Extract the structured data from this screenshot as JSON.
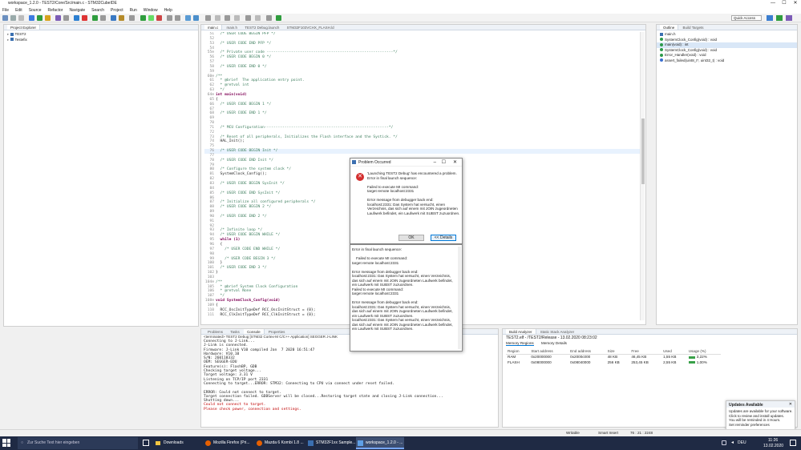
{
  "window": {
    "title": "workspace_1.2.0 - TEST2/Core/Src/main.c - STM32CubeIDE",
    "controls": [
      "—",
      "☐",
      "✕"
    ]
  },
  "menu": [
    "File",
    "Edit",
    "Source",
    "Refactor",
    "Navigate",
    "Search",
    "Project",
    "Run",
    "Window",
    "Help"
  ],
  "quick_access": "Quick Access",
  "project_explorer": {
    "title": "Project Explorer",
    "items": [
      "TEST2",
      "Testefix"
    ]
  },
  "editor": {
    "tabs": [
      "main.c",
      "main.h",
      "TEST2 Debug.launch",
      "STM32F103VCHX_FLASH.ld"
    ],
    "lines": [
      {
        "n": "51",
        "t": "  /* USER CODE BEGIN PFP */",
        "c": "cm"
      },
      {
        "n": "52",
        "t": "",
        "c": ""
      },
      {
        "n": "53",
        "t": "  /* USER CODE END PFP */",
        "c": "cm"
      },
      {
        "n": "54",
        "t": "",
        "c": ""
      },
      {
        "n": "55⊖",
        "t": "  /* Private user code ---------------------------------------------------------*/",
        "c": "cm"
      },
      {
        "n": "56",
        "t": "  /* USER CODE BEGIN 0 */",
        "c": "cm"
      },
      {
        "n": "57",
        "t": "",
        "c": ""
      },
      {
        "n": "58",
        "t": "  /* USER CODE END 0 */",
        "c": "cm"
      },
      {
        "n": "59",
        "t": "",
        "c": ""
      },
      {
        "n": "60⊖",
        "t": "/**",
        "c": "cm"
      },
      {
        "n": "61",
        "t": "  * @brief  The application entry point.",
        "c": "cm"
      },
      {
        "n": "62",
        "t": "  * @retval int",
        "c": "cm"
      },
      {
        "n": "63",
        "t": "  */",
        "c": "cm"
      },
      {
        "n": "64⊖",
        "t": "int main(void)",
        "c": "kw"
      },
      {
        "n": "65",
        "t": "{",
        "c": ""
      },
      {
        "n": "66",
        "t": "  /* USER CODE BEGIN 1 */",
        "c": "cm"
      },
      {
        "n": "67",
        "t": "",
        "c": ""
      },
      {
        "n": "68",
        "t": "  /* USER CODE END 1 */",
        "c": "cm"
      },
      {
        "n": "69",
        "t": "",
        "c": ""
      },
      {
        "n": "70",
        "t": "",
        "c": ""
      },
      {
        "n": "71",
        "t": "  /* MCU Configuration--------------------------------------------------------*/",
        "c": "cm"
      },
      {
        "n": "72",
        "t": "",
        "c": ""
      },
      {
        "n": "73",
        "t": "  /* Reset of all peripherals, Initializes the Flash interface and the Systick. */",
        "c": "cm"
      },
      {
        "n": "74",
        "t": "  HAL_Init();",
        "c": ""
      },
      {
        "n": "75",
        "t": "",
        "c": ""
      },
      {
        "n": "76",
        "t": "  /* USER CODE BEGIN Init */",
        "c": "cm hl"
      },
      {
        "n": "77",
        "t": "",
        "c": ""
      },
      {
        "n": "78",
        "t": "  /* USER CODE END Init */",
        "c": "cm"
      },
      {
        "n": "79",
        "t": "",
        "c": ""
      },
      {
        "n": "80",
        "t": "  /* Configure the system clock */",
        "c": "cm"
      },
      {
        "n": "81",
        "t": "  SystemClock_Config();",
        "c": ""
      },
      {
        "n": "82",
        "t": "",
        "c": ""
      },
      {
        "n": "83",
        "t": "  /* USER CODE BEGIN SysInit */",
        "c": "cm"
      },
      {
        "n": "84",
        "t": "",
        "c": ""
      },
      {
        "n": "85",
        "t": "  /* USER CODE END SysInit */",
        "c": "cm"
      },
      {
        "n": "86",
        "t": "",
        "c": ""
      },
      {
        "n": "87",
        "t": "  /* Initialize all configured peripherals */",
        "c": "cm"
      },
      {
        "n": "88",
        "t": "  /* USER CODE BEGIN 2 */",
        "c": "cm"
      },
      {
        "n": "89",
        "t": "",
        "c": ""
      },
      {
        "n": "90",
        "t": "  /* USER CODE END 2 */",
        "c": "cm"
      },
      {
        "n": "91",
        "t": "",
        "c": ""
      },
      {
        "n": "92",
        "t": "",
        "c": ""
      },
      {
        "n": "93",
        "t": "  /* Infinite loop */",
        "c": "cm"
      },
      {
        "n": "94",
        "t": "  /* USER CODE BEGIN WHILE */",
        "c": "cm"
      },
      {
        "n": "95",
        "t": "  while (1)",
        "c": "kw"
      },
      {
        "n": "96",
        "t": "  {",
        "c": ""
      },
      {
        "n": "97",
        "t": "    /* USER CODE END WHILE */",
        "c": "cm"
      },
      {
        "n": "98",
        "t": "",
        "c": ""
      },
      {
        "n": "99",
        "t": "    /* USER CODE BEGIN 3 */",
        "c": "cm"
      },
      {
        "n": "100",
        "t": "  }",
        "c": ""
      },
      {
        "n": "101",
        "t": "  /* USER CODE END 3 */",
        "c": "cm"
      },
      {
        "n": "102",
        "t": "}",
        "c": ""
      },
      {
        "n": "103",
        "t": "",
        "c": ""
      },
      {
        "n": "104⊖",
        "t": "/**",
        "c": "cm"
      },
      {
        "n": "105",
        "t": "  * @brief System Clock Configuration",
        "c": "cm"
      },
      {
        "n": "106",
        "t": "  * @retval None",
        "c": "cm"
      },
      {
        "n": "107",
        "t": "  */",
        "c": "cm"
      },
      {
        "n": "108⊖",
        "t": "void SystemClock_Config(void)",
        "c": "kw"
      },
      {
        "n": "109",
        "t": "{",
        "c": ""
      },
      {
        "n": "110",
        "t": "  RCC_OscInitTypeDef RCC_OscInitStruct = {0};",
        "c": ""
      },
      {
        "n": "111",
        "t": "  RCC_ClkInitTypeDef RCC_ClkInitStruct = {0};",
        "c": ""
      }
    ]
  },
  "outline": {
    "tabs": [
      "Outline",
      "Build Targets"
    ],
    "items": [
      {
        "label": "main.h",
        "kind": "sq"
      },
      {
        "label": "SystemClock_Config(void) : void",
        "kind": "dot"
      },
      {
        "label": "main(void) : int",
        "kind": "dot"
      },
      {
        "label": "SystemClock_Config(void) : void",
        "kind": "dot"
      },
      {
        "label": "Error_Handler(void) : void",
        "kind": "dot"
      },
      {
        "label": "assert_failed(uint8_t*, uint32_t) : void",
        "kind": "dot"
      }
    ]
  },
  "console": {
    "tabs": [
      "Problems",
      "Tasks",
      "Console",
      "Properties"
    ],
    "header": "<terminated> TEST2 Debug [STM32 Cortex-M C/C++ Application] SEGGER J-LINK",
    "lines": [
      {
        "t": "Connecting to J-Link...",
        "c": ""
      },
      {
        "t": "J-Link is connected.",
        "c": ""
      },
      {
        "t": "Firmware: J-Link V10 compiled Jan  7 2020 16:51:47",
        "c": ""
      },
      {
        "t": "Hardware: V10.10",
        "c": ""
      },
      {
        "t": "S/N: 260118332",
        "c": ""
      },
      {
        "t": "OEM: SEGGER-EDU",
        "c": ""
      },
      {
        "t": "Feature(s): FlashBP, GDB",
        "c": ""
      },
      {
        "t": "Checking target voltage...",
        "c": ""
      },
      {
        "t": "Target voltage: 3.31 V",
        "c": ""
      },
      {
        "t": "Listening on TCP/IP port 2331",
        "c": ""
      },
      {
        "t": "Connecting to target...ERROR: STM32: Connecting to CPU via connect under reset failed.",
        "c": ""
      },
      {
        "t": "",
        "c": ""
      },
      {
        "t": "ERROR: Could not connect to target.",
        "c": ""
      },
      {
        "t": "Target connection failed. GDBServer will be closed...Restoring target state and closing J-Link connection...",
        "c": ""
      },
      {
        "t": "Shutting down...",
        "c": ""
      },
      {
        "t": "Could not connect to target.",
        "c": "red"
      },
      {
        "t": "Please check power, connection and settings.",
        "c": "red"
      }
    ]
  },
  "build_analyzer": {
    "tabs": [
      "Build Analyzer",
      "Static Stack Analyzer"
    ],
    "file": "TEST2.elf - /TEST2/Release - 13.02.2020 08:23:02",
    "subtabs": [
      "Memory Regions",
      "Memory Details"
    ],
    "columns": [
      "Region",
      "Start address",
      "End address",
      "Size",
      "Free",
      "Used",
      "Usage (%)"
    ],
    "rows": [
      [
        "RAM",
        "0x20000000",
        "0x2000c000",
        "48 KB",
        "46,45 KB",
        "1,55 KB",
        "3,22%"
      ],
      [
        "FLASH",
        "0x08000000",
        "0x08040000",
        "256 KB",
        "253,45 KB",
        "2,55 KB",
        "1,00%"
      ]
    ]
  },
  "problem_dialog": {
    "title": "Problem Occurred",
    "message": "'Launching TEST2 Debug' has encountered a problem.\nError in final launch sequence:\n\nFailed to execute MI command:\ntarget remote localhost:2331\n\nError message from debugger back end:\nlocalhost:2331: Das System hat versucht, einen\nVerzeichnis, das sich auf einem mit JOIN zugeordneten\nLaufwerk befindet, ein Laufwerk mit SUBST zuzuordnen.",
    "ok": "OK",
    "details": "<< Details",
    "details_text": "Error in final launch sequence:\n\n    Failed to execute MI command:\ntarget remote localhost:2331\n\nError message from debugger back end:\nlocalhost:2331: Das System hat versucht, einen Verzeichnis,\ndas sich auf einem mit JOIN zugeordneten Laufwerk befindet,\nein Laufwerk mit SUBST zuzuordnen.\nFailed to execute MI command:\ntarget remote localhost:2331\n\nError message from debugger back end:\nlocalhost:2331: Das System hat versucht, einen Verzeichnis,\ndas sich auf einem mit JOIN zugeordneten Laufwerk befindet,\nein Laufwerk mit SUBST zuzuordnen.\nlocalhost:2331: Das System hat versucht, einen Verzeichnis,\ndas sich auf einem mit JOIN zugeordneten Laufwerk befindet,\nein Laufwerk mit SUBST zuzuordnen."
  },
  "status": {
    "writable": "Writable",
    "insert": "Smart Insert",
    "pos": "76 : 21 : 2248"
  },
  "notification": {
    "title": "Updates Available",
    "text": "Updates are available for your software.\nClick to review and install updates.\nYou will be reminded in 4 Hours.\nSet reminder preferences"
  },
  "taskbar": {
    "search": "Zur Suche Text hier eingeben",
    "apps": [
      "Downloads",
      "Mozilla Firefox (Pri...",
      "Mazda 6 Kombi 1.8 ...",
      "STM32F1xx Sample...",
      "workspace_1.2.0 - ..."
    ],
    "time": "11:26",
    "date": "13.02.2020",
    "lang": "DEU"
  },
  "colors": {
    "accent": "#0078d7",
    "error": "#d32f2f",
    "taskbar": "#1f2a44"
  }
}
